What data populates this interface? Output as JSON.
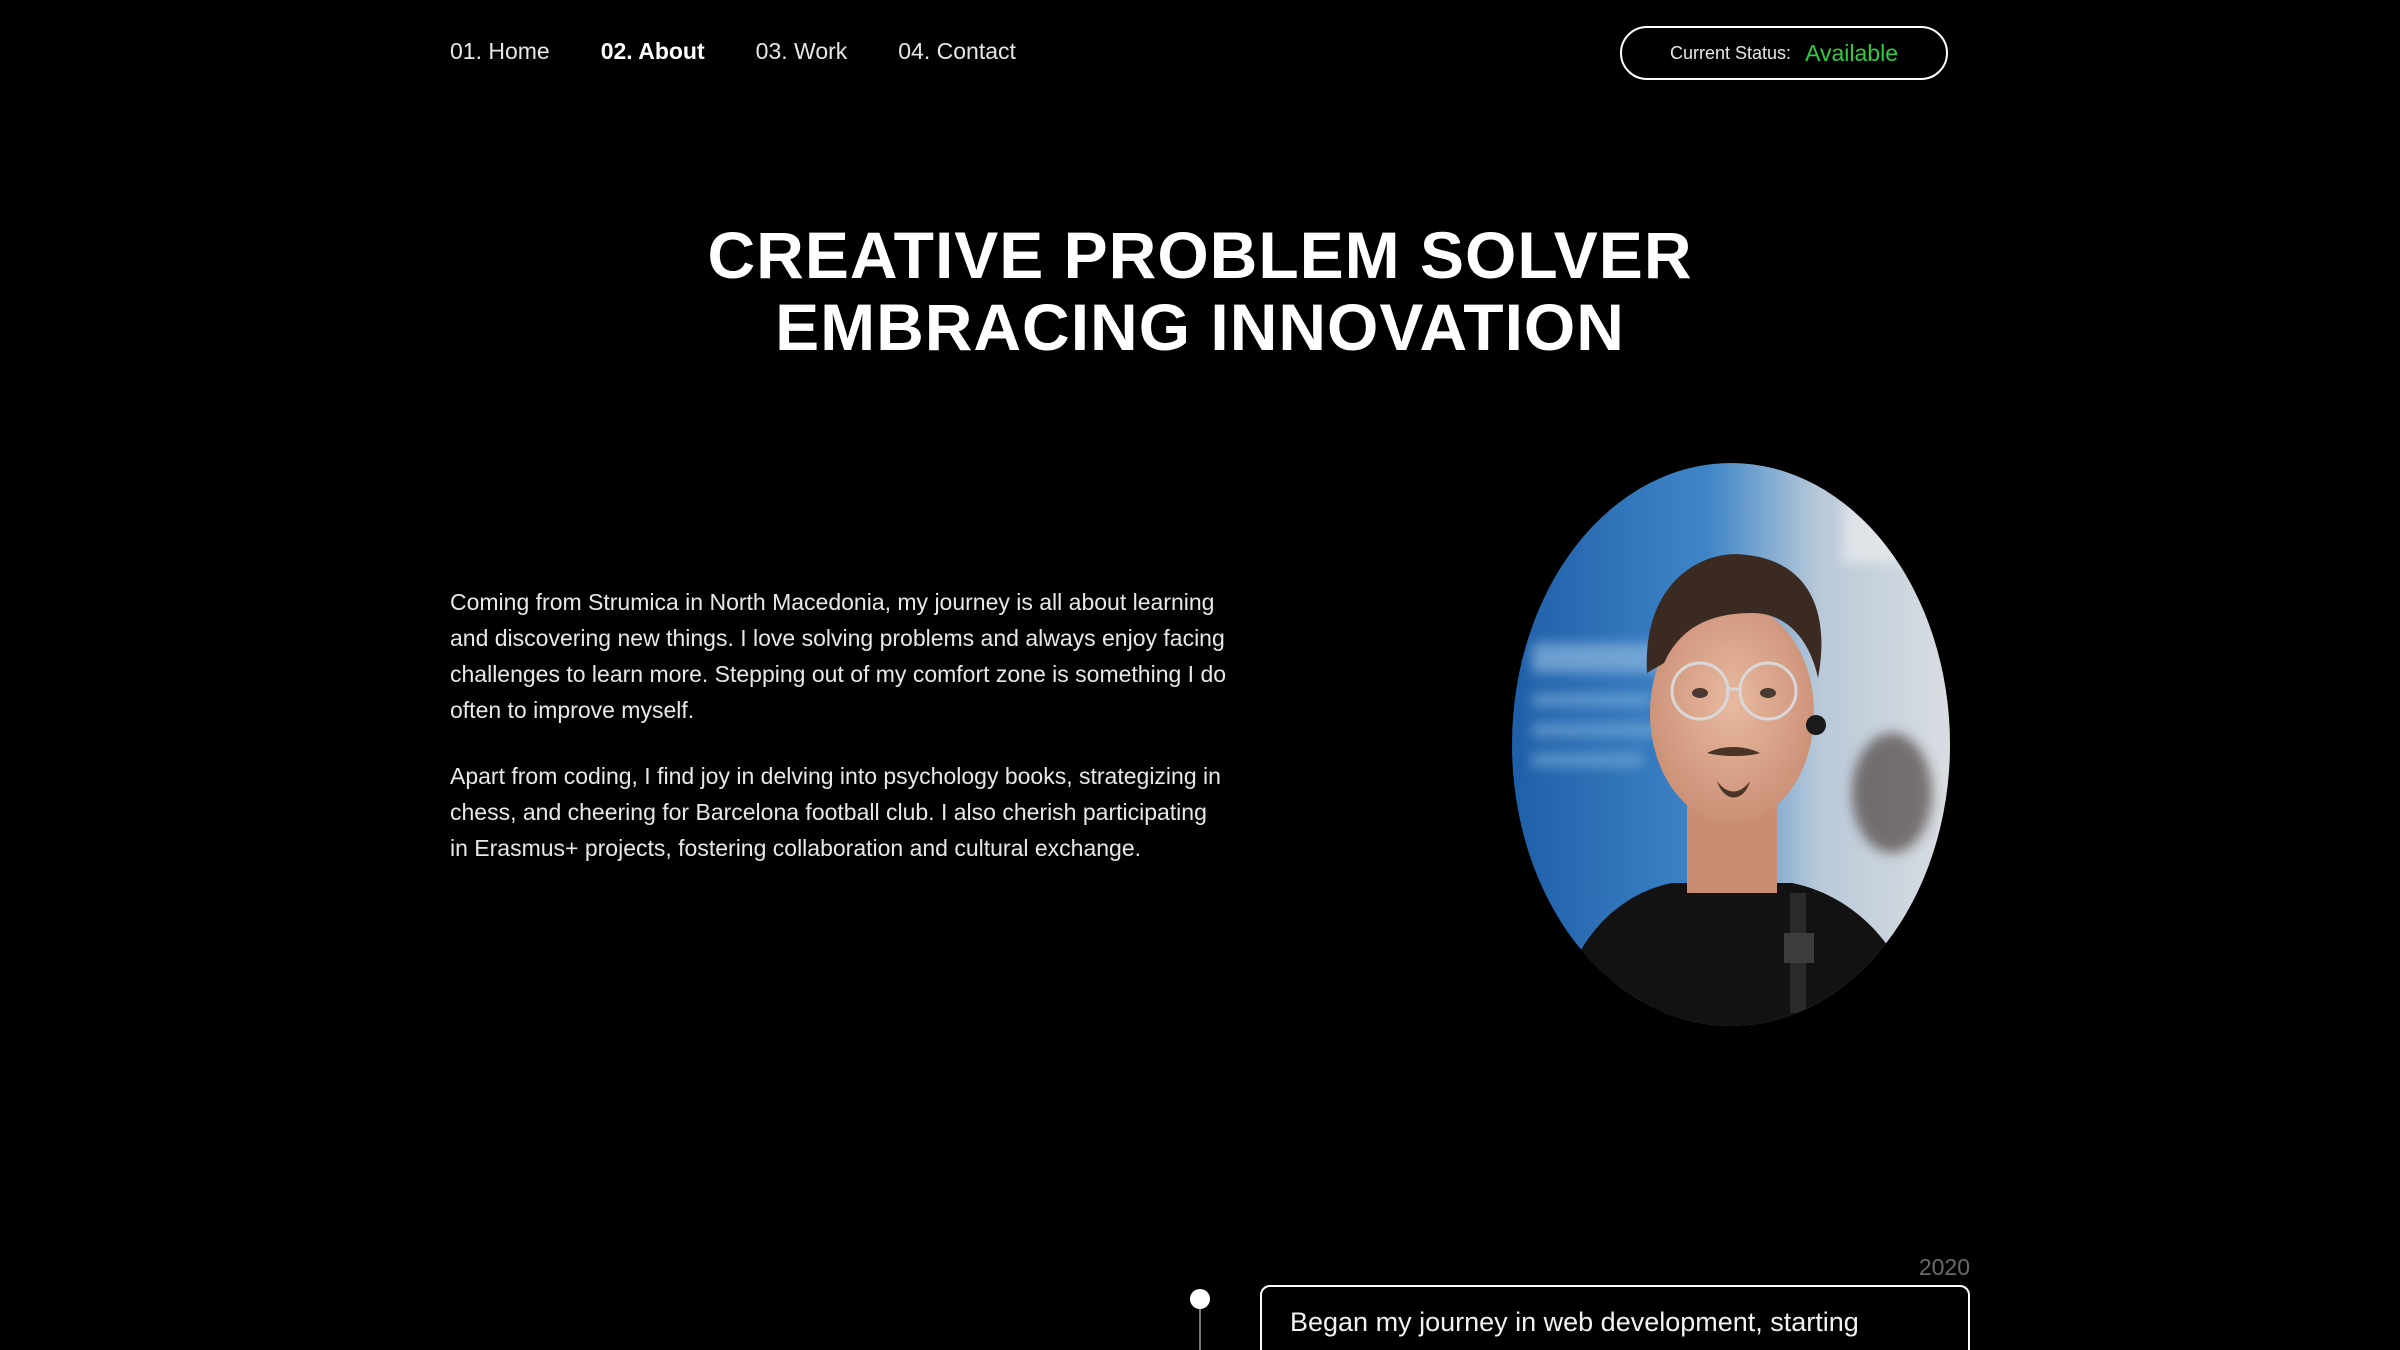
{
  "nav": {
    "items": [
      {
        "label": "01. Home"
      },
      {
        "label": "02. About"
      },
      {
        "label": "03. Work"
      },
      {
        "label": "04. Contact"
      }
    ]
  },
  "status": {
    "label": "Current Status:",
    "value": "Available",
    "value_color": "#2ecc40"
  },
  "hero": {
    "line1": "CREATIVE PROBLEM SOLVER",
    "line2": "EMBRACING INNOVATION"
  },
  "about": {
    "paragraph1": "Coming from Strumica in North Macedonia, my journey is all about learning and discovering new things. I love solving problems and always enjoy facing challenges to learn more. Stepping out of my comfort zone is something I do often to improve myself.",
    "paragraph2": "Apart from coding, I find joy in delving into psychology books, strategizing in chess, and cheering for Barcelona football club. I also cherish participating in Erasmus+ projects, fostering collaboration and cultural exchange."
  },
  "portrait": {
    "icon": "person-photo"
  },
  "timeline": {
    "entries": [
      {
        "year": "2020",
        "text": "Began my journey in web development, starting"
      }
    ]
  }
}
